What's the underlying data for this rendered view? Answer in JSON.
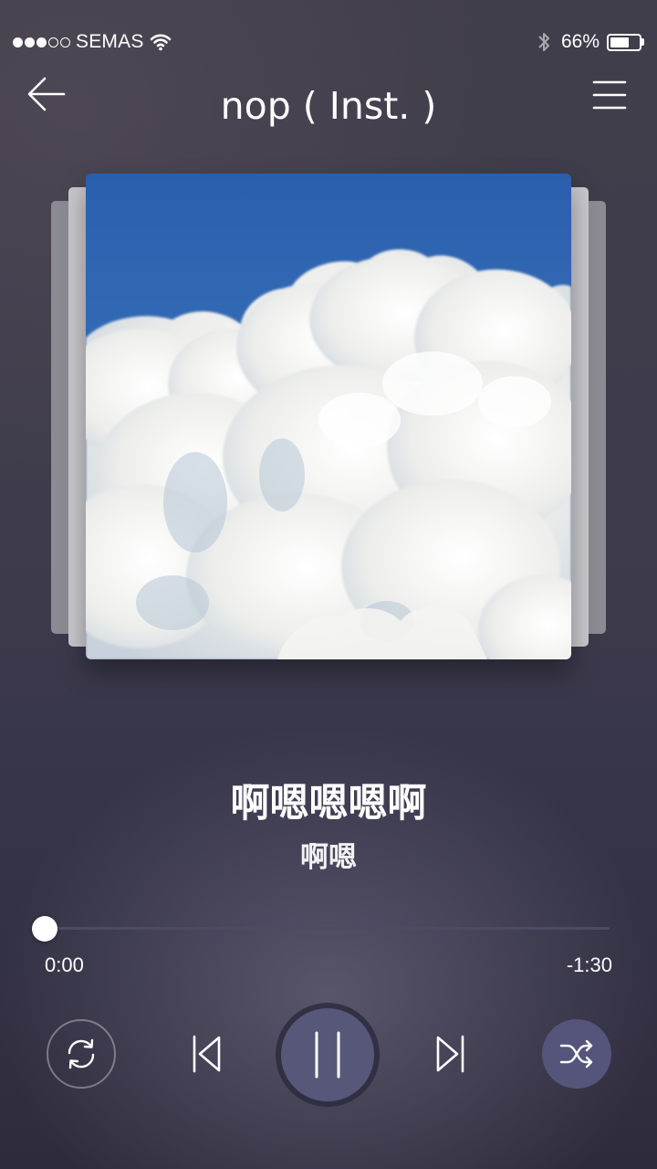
{
  "status_bar": {
    "signal_filled": 3,
    "signal_total": 5,
    "carrier": "SEMAS",
    "wifi_icon": "wifi-icon",
    "bluetooth_icon": "bluetooth-icon",
    "battery_percent": "66%",
    "battery_level": 0.66
  },
  "header": {
    "back_icon": "arrow-left-icon",
    "title": "nop ( Inst. )",
    "menu_icon": "hamburger-menu-icon"
  },
  "song": {
    "title": "啊嗯嗯嗯啊",
    "artist": "啊嗯"
  },
  "progress": {
    "current_time": "0:00",
    "remaining_time": "-1:30",
    "fraction": 0.0
  },
  "controls": {
    "repeat_icon": "repeat-icon",
    "prev_icon": "skip-previous-icon",
    "play_pause_icon": "pause-icon",
    "next_icon": "skip-next-icon",
    "shuffle_icon": "shuffle-icon"
  },
  "colors": {
    "accent": "#575879",
    "shuffle_active": "#55547a",
    "track": "#4d4b63"
  }
}
